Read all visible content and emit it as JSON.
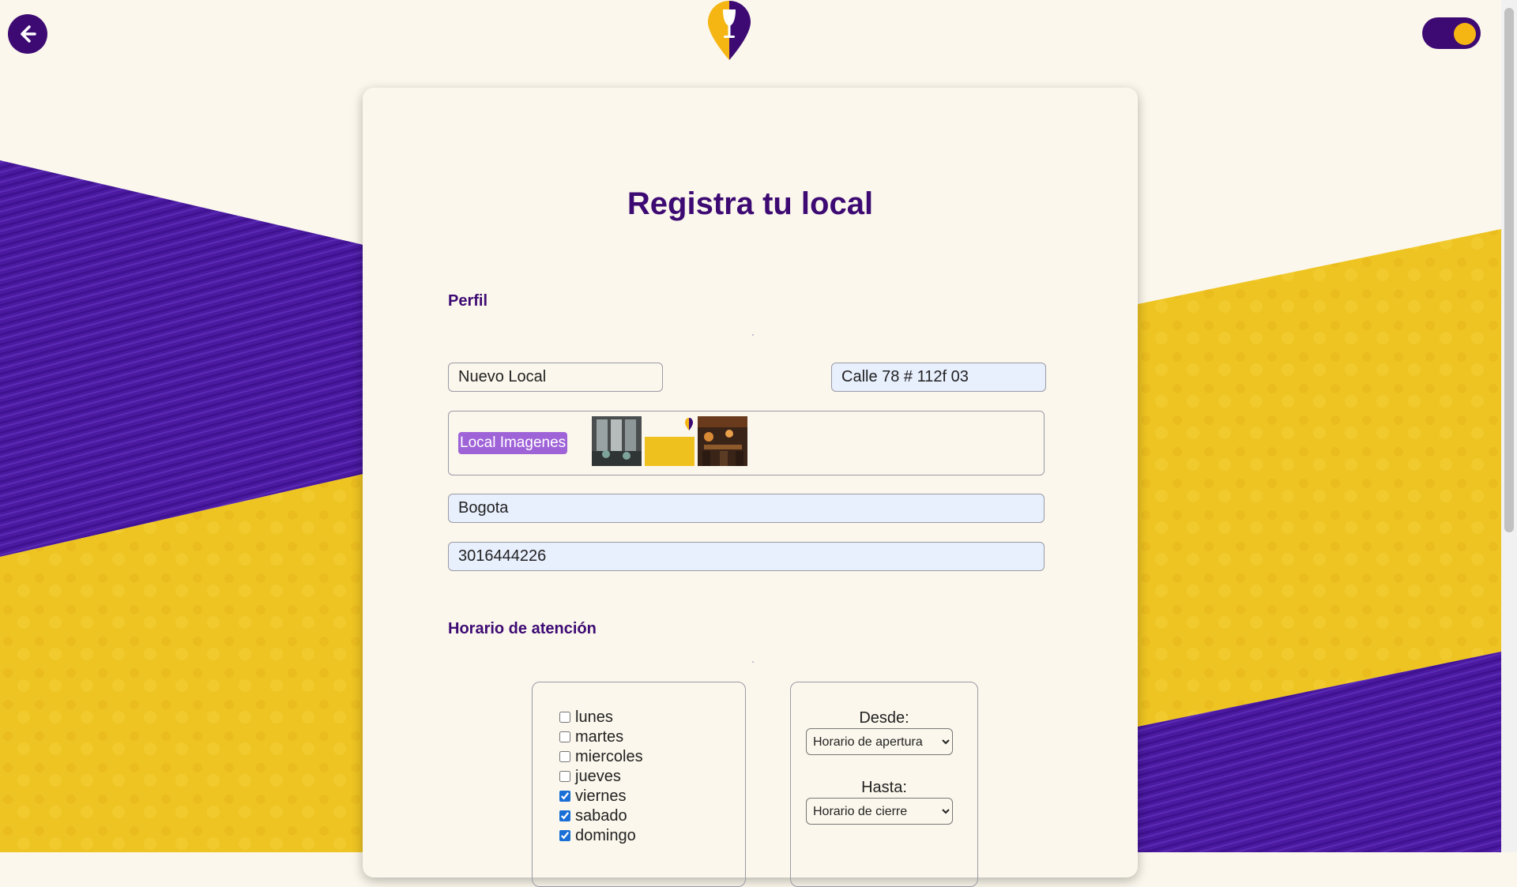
{
  "colors": {
    "brand_purple": "#3d0a73",
    "brand_yellow": "#f5b614",
    "page_bg": "#fbf7ec",
    "button_purple": "#9f63d8",
    "field_filled_bg": "#e8effd"
  },
  "header": {
    "back_icon": "arrow-left-icon",
    "logo_icon": "wine-glass-location-pin-logo",
    "theme_toggle": {
      "state": "on"
    }
  },
  "form": {
    "title": "Registra tu local",
    "profile": {
      "heading": "Perfil",
      "name_value": "Nuevo Local",
      "address_value": "Calle 78 # 112f 03",
      "images_button_label": "Local Imagenes",
      "images": [
        "restaurant-interior-thumbnail",
        "yellow-logo-thumbnail",
        "bar-interior-thumbnail"
      ],
      "city_value": "Bogota",
      "phone_value": "3016444226"
    },
    "schedule": {
      "heading": "Horario de atención",
      "days": [
        {
          "label": "lunes",
          "checked": false
        },
        {
          "label": "martes",
          "checked": false
        },
        {
          "label": "miercoles",
          "checked": false
        },
        {
          "label": "jueves",
          "checked": false
        },
        {
          "label": "viernes",
          "checked": true
        },
        {
          "label": "sabado",
          "checked": true
        },
        {
          "label": "domingo",
          "checked": true
        }
      ],
      "from_label": "Desde:",
      "from_selected": "Horario de apertura",
      "to_label": "Hasta:",
      "to_selected": "Horario de cierre"
    }
  }
}
